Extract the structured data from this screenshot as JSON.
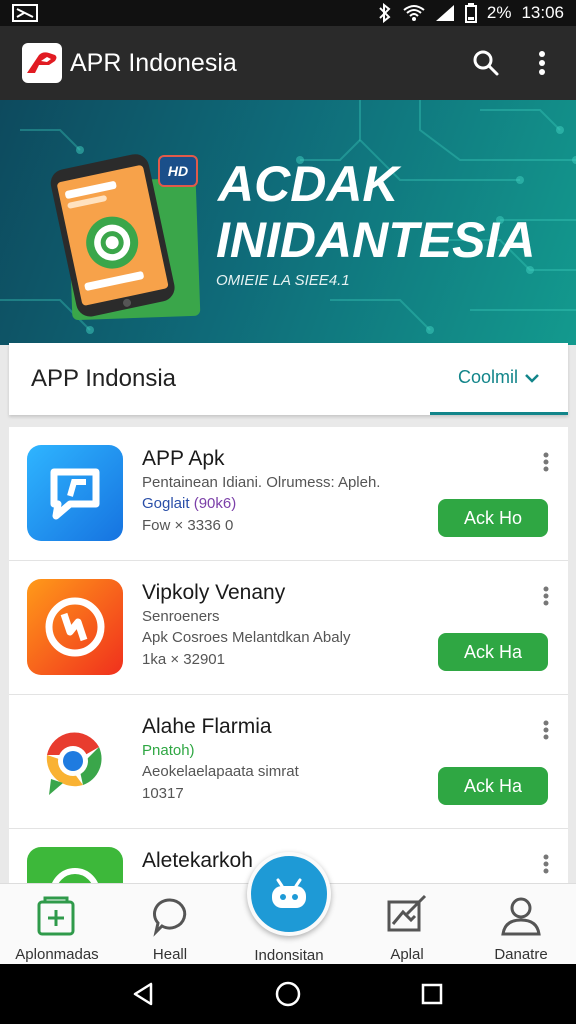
{
  "status_bar": {
    "battery_text": "2%",
    "time": "13:06"
  },
  "app_bar": {
    "title": "APR Indonesia",
    "search_icon": "search-icon",
    "more_icon": "more-vert-icon"
  },
  "banner": {
    "hd_badge": "HD",
    "title_line1": "ACDAK",
    "title_line2": "INIDANTESIA",
    "subtitle": "OMIEIE LA SIEE4.1"
  },
  "section": {
    "title": "APP Indonsia",
    "link_label": "Coolmil"
  },
  "apps": [
    {
      "name": "APP Apk",
      "line2": "Pentainean Idiani. Olrumess: Apleh.",
      "line3": "Goglait",
      "line3_extra": "(90k6)",
      "line4": "Fow  × 3336 0",
      "button": "Ack Ho"
    },
    {
      "name": "Vipkoly Venany",
      "line2": "Senroeners",
      "line3": "Apk Cosroes Melantdkan Abaly",
      "line4": "1ka  × 32901",
      "button": "Ack Ha"
    },
    {
      "name": "Alahe Flarmia",
      "line2": "Pnatoh)",
      "line3": "Aeokelaelapaata simrat",
      "line4": "10317",
      "button": "Ack Ha"
    },
    {
      "name": "Aletekarkoh",
      "line2": "",
      "line3": "",
      "line4": ""
    }
  ],
  "bottom_nav": [
    {
      "label": "Aplonmadas",
      "icon": "add-app-icon"
    },
    {
      "label": "Heall",
      "icon": "chat-bubble-icon"
    },
    {
      "label": "Indonsitan",
      "icon": "robot-icon"
    },
    {
      "label": "Aplal",
      "icon": "image-edit-icon"
    },
    {
      "label": "Danatre",
      "icon": "person-icon"
    }
  ],
  "colors": {
    "accent": "#12858a",
    "install": "#2fa743",
    "fab": "#1e9ad6",
    "app_bar": "#2a2a2a"
  }
}
